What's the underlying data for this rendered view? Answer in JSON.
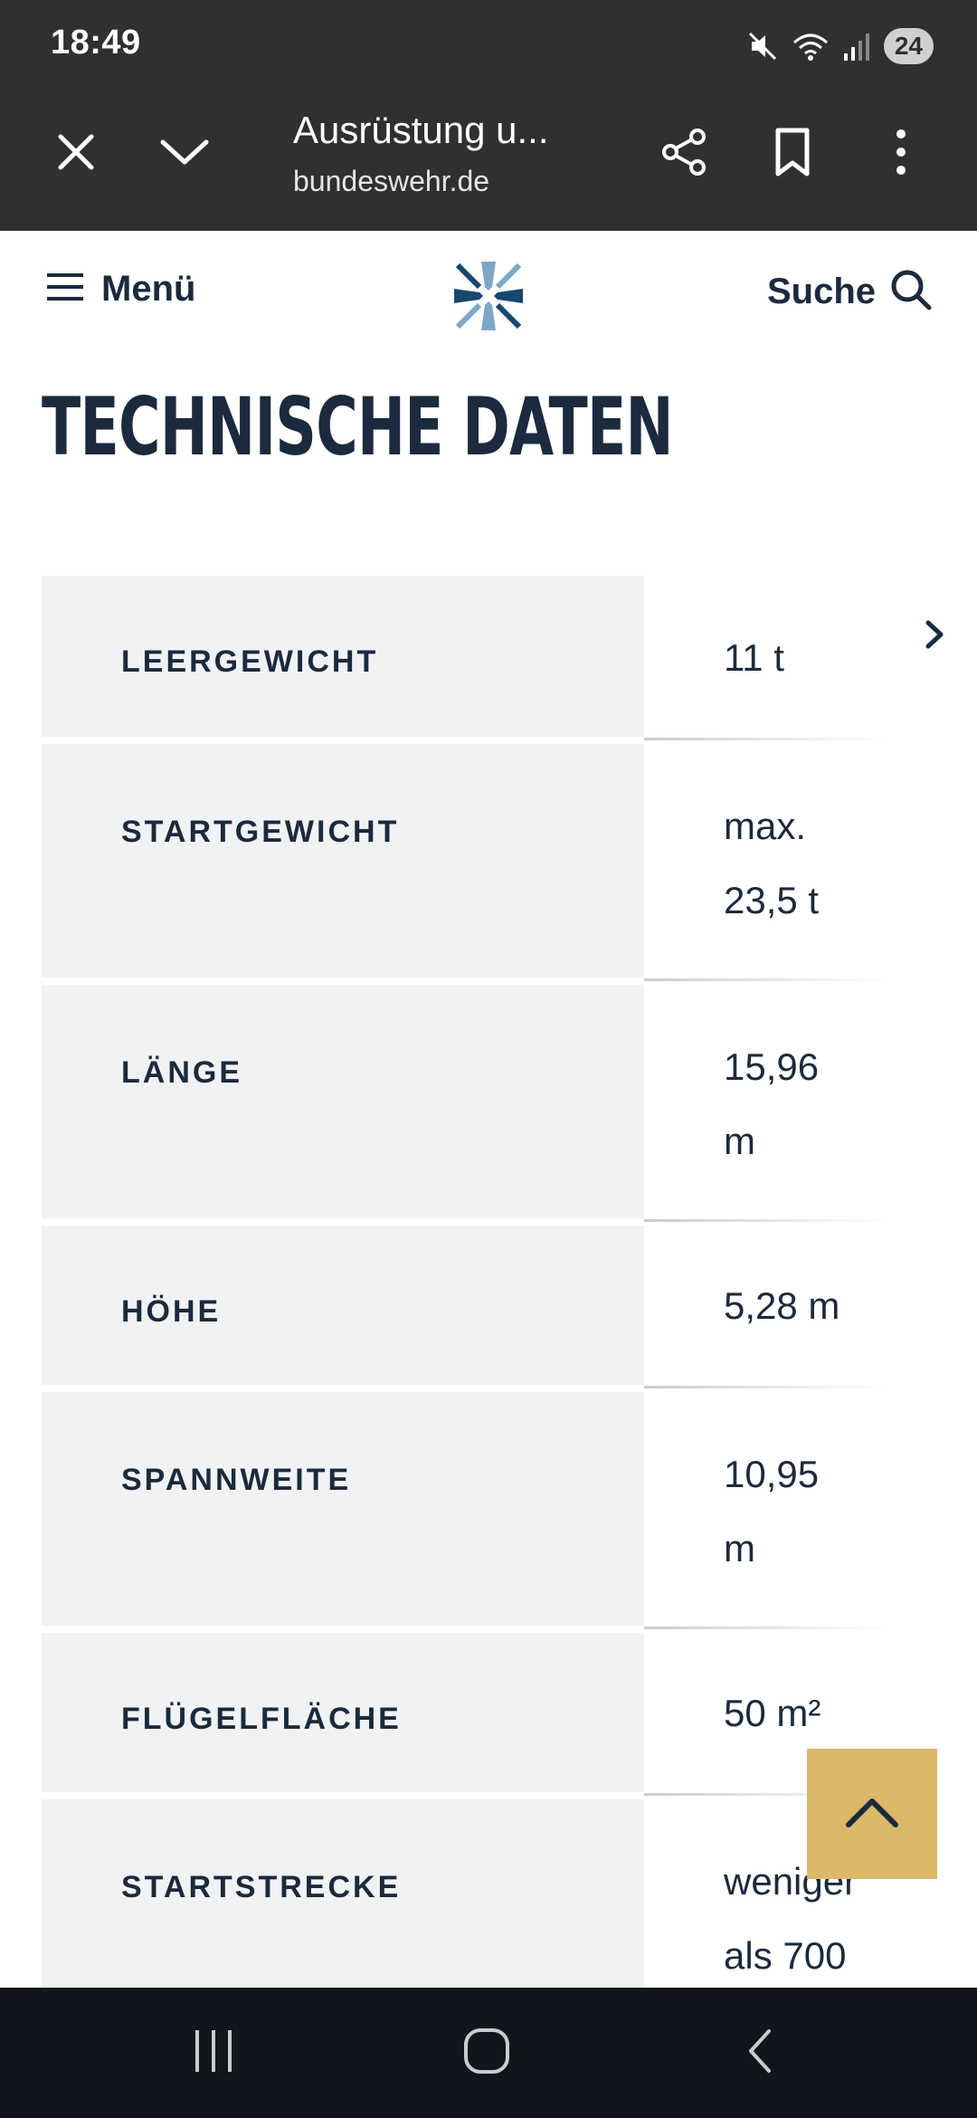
{
  "status_bar": {
    "time": "18:49",
    "battery": "24",
    "icons": [
      "mute-icon",
      "wifi-icon",
      "signal-icon"
    ]
  },
  "browser": {
    "page_title": "Ausrüstung u...",
    "url": "bundeswehr.de",
    "icons": [
      "close-icon",
      "chevron-down-icon",
      "share-icon",
      "bookmark-icon",
      "more-icon"
    ]
  },
  "site_header": {
    "menu_label": "Menü",
    "search_label": "Suche",
    "logo": "bundeswehr-cross-logo"
  },
  "section": {
    "title": "TECHNISCHE DATEN"
  },
  "table": {
    "rows": [
      {
        "label": "LEERGEWICHT",
        "value_lines": [
          "11 t"
        ]
      },
      {
        "label": "STARTGEWICHT",
        "value_lines": [
          "max.",
          "23,5 t"
        ]
      },
      {
        "label": "LÄNGE",
        "value_lines": [
          "15,96",
          "m"
        ]
      },
      {
        "label": "HÖHE",
        "value_lines": [
          "5,28 m"
        ]
      },
      {
        "label": "SPANNWEITE",
        "value_lines": [
          "10,95",
          "m"
        ]
      },
      {
        "label": "FLÜGELFLÄCHE",
        "value_lines": [
          "50 m²"
        ]
      },
      {
        "label": "STARTSTRECKE",
        "value_lines": [
          "weniger",
          "als 700"
        ]
      }
    ]
  },
  "colors": {
    "chrome": "#2f3032",
    "navy": "#1b2a3d",
    "label_bg": "#f1f2f4",
    "accent_gold": "#dcb86a",
    "nav_bar": "#12151b"
  }
}
